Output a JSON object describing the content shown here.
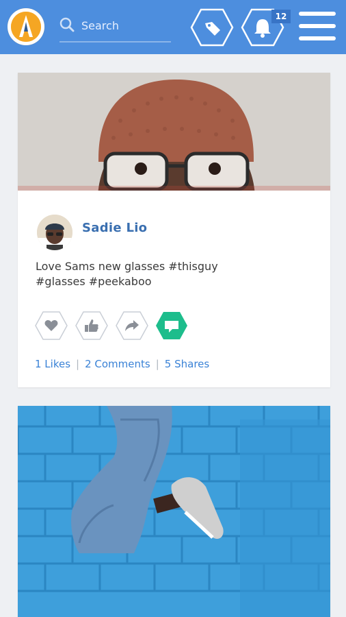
{
  "header": {
    "search_placeholder": "Search",
    "notification_count": "12",
    "colors": {
      "bar": "#4d8ede",
      "logo": "#f5a623",
      "accent_green": "#1dbd8c"
    },
    "icons": [
      "logo",
      "search-icon",
      "tag-icon",
      "bell-icon",
      "menu-icon"
    ]
  },
  "feed": {
    "posts": [
      {
        "author": "Sadie Lio",
        "text": "Love Sams new glasses #thisguy\n#glasses #peekaboo",
        "actions": [
          "heart-icon",
          "thumbs-up-icon",
          "share-icon",
          "comment-icon"
        ],
        "active_action": "comment-icon",
        "likes": "1 Likes",
        "comments": "2 Comments",
        "shares": "5 Shares"
      }
    ]
  }
}
